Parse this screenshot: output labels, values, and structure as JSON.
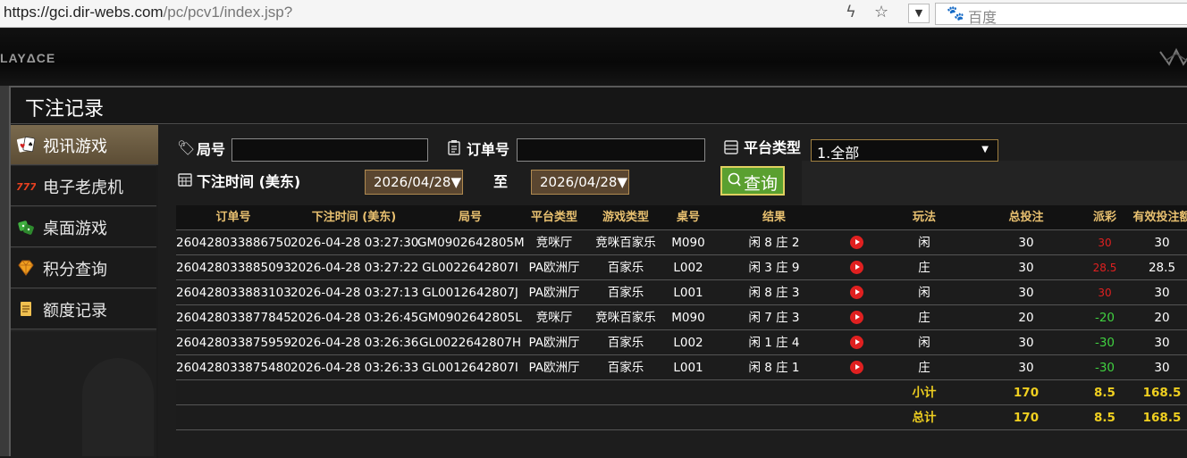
{
  "browser": {
    "url_host": "https://gci.dir-webs.com",
    "url_path": "/pc/pcv1/index.jsp?",
    "search_engine": "百度"
  },
  "site": {
    "logo_text": "LAYΔCE"
  },
  "modal": {
    "title": "下注记录",
    "sidebar": [
      {
        "label": "视讯游戏",
        "icon": "cards-icon",
        "active": true
      },
      {
        "label": "电子老虎机",
        "icon": "slot-777-icon",
        "active": false
      },
      {
        "label": "桌面游戏",
        "icon": "dice-icon",
        "active": false
      },
      {
        "label": "积分查询",
        "icon": "diamond-icon",
        "active": false
      },
      {
        "label": "额度记录",
        "icon": "document-icon",
        "active": false
      }
    ],
    "filters": {
      "round_label": "局号",
      "order_label": "订单号",
      "platform_label": "平台类型",
      "platform_value": "1.全部",
      "time_label": "下注时间 (美东)",
      "date_from": "2026/04/28▼",
      "to_label": "至",
      "date_to": "2026/04/28▼",
      "query_label": "查询"
    },
    "table": {
      "headers": [
        "订单号",
        "下注时间 (美东)",
        "局号",
        "平台类型",
        "游戏类型",
        "桌号",
        "结果",
        "",
        "玩法",
        "总投注",
        "派彩",
        "有效投注额"
      ],
      "rows": [
        [
          "260428033886750",
          "2026-04-28 03:27:30",
          "GM0902642805M",
          "竞咪厅",
          "竞咪百家乐",
          "M090",
          "闲 8 庄 2",
          "闲",
          "30",
          "30",
          "30"
        ],
        [
          "260428033885093",
          "2026-04-28 03:27:22",
          "GL0022642807I",
          "PA欧洲厅",
          "百家乐",
          "L002",
          "闲 3 庄 9",
          "庄",
          "30",
          "28.5",
          "28.5"
        ],
        [
          "260428033883103",
          "2026-04-28 03:27:13",
          "GL0012642807J",
          "PA欧洲厅",
          "百家乐",
          "L001",
          "闲 8 庄 3",
          "闲",
          "30",
          "30",
          "30"
        ],
        [
          "260428033877845",
          "2026-04-28 03:26:45",
          "GM0902642805L",
          "竞咪厅",
          "竞咪百家乐",
          "M090",
          "闲 7 庄 3",
          "庄",
          "20",
          "-20",
          "20"
        ],
        [
          "260428033875959",
          "2026-04-28 03:26:36",
          "GL0022642807H",
          "PA欧洲厅",
          "百家乐",
          "L002",
          "闲 1 庄 4",
          "闲",
          "30",
          "-30",
          "30"
        ],
        [
          "260428033875480",
          "2026-04-28 03:26:33",
          "GL0012642807I",
          "PA欧洲厅",
          "百家乐",
          "L001",
          "闲 8 庄 1",
          "庄",
          "30",
          "-30",
          "30"
        ]
      ],
      "subtotal": {
        "label": "小计",
        "bet": "170",
        "payout": "8.5",
        "valid": "168.5"
      },
      "total": {
        "label": "总计",
        "bet": "170",
        "payout": "8.5",
        "valid": "168.5"
      }
    }
  },
  "colors": {
    "accent_gold": "#e8c070",
    "win_red": "#e02020",
    "loss_green": "#40d040",
    "sum_yellow": "#f0d020",
    "query_green": "#5aa030"
  }
}
